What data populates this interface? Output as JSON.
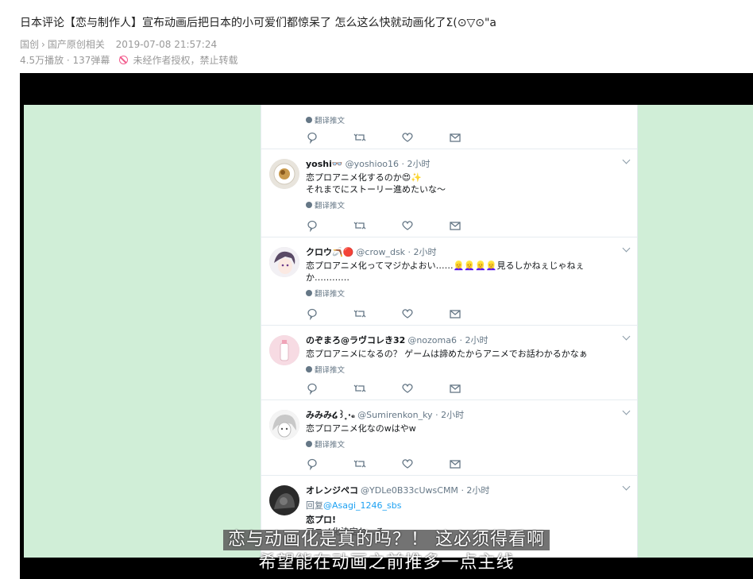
{
  "video": {
    "title": "日本评论【恋与制作人】宣布动画后把日本的小可爱们都惊呆了 怎么这么快就动画化了Σ(⊙▽⊙\"a",
    "breadcrumb": [
      "国创",
      "国产原创相关"
    ],
    "date": "2019-07-08 21:57:24",
    "stats": "4.5万播放 · 137弹幕",
    "copyright_notice": "未经作者授权，禁止转载"
  },
  "tweets": [
    {
      "name": "",
      "handle": "",
      "time": "",
      "lines": [],
      "translate": "翻译推文",
      "partial": true
    },
    {
      "name": "yoshi👓",
      "handle": "@yoshioo16",
      "time": "· 2小时",
      "lines": [
        "恋プロアニメ化するのか😍✨",
        "それまでにストーリー進めたいな～"
      ],
      "translate": "翻译推文"
    },
    {
      "name": "クロウ🪃🔴",
      "handle": "@crow_dsk",
      "time": "· 2小时",
      "lines": [
        "恋プロアニメ化ってマジかよおい……👱‍♀️👱‍♀️👱‍♀️👱‍♀️見るしかねぇじゃねぇ",
        "か…………"
      ],
      "translate": "翻译推文"
    },
    {
      "name": "のぞまろ@ラヴコレき32",
      "handle": "@nozoma6",
      "time": "· 2小时",
      "lines": [
        "恋プロアニメになるの？ ゲームは諦めたからアニメでお話わかるかなぁ"
      ],
      "translate": "翻译推文"
    },
    {
      "name": "みみみ໒꒱ ̥‧ₑ",
      "handle": "@Sumirenkon_ky",
      "time": "· 2小时",
      "lines": [
        "恋プロアニメ化なのwはやw"
      ],
      "translate": "翻译推文"
    },
    {
      "name": "オレンジペコ",
      "handle": "@YDLe0B33cUwsCMM",
      "time": "· 2小时",
      "reply_prefix": "回复",
      "reply_to": "@Asagi_1246_sbs",
      "lines": [
        "恋プロ!",
        "アニメ化決定ね…ろ"
      ],
      "translate": ""
    }
  ],
  "subtitles": {
    "line1": "恋与动画化是真的吗？！ 这必须得看啊",
    "line2": "希望能在动画之前推多一点主线"
  },
  "colors": {
    "background_frame": "#d0eed7",
    "accent_pink": "#f25d8e",
    "link_blue": "#1da1f2"
  }
}
